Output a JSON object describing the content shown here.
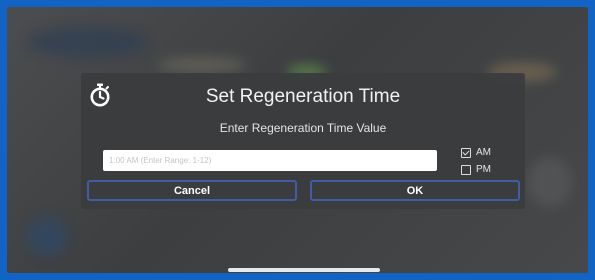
{
  "dialog": {
    "title": "Set Regeneration Time",
    "subtitle": "Enter Regeneration Time Value",
    "input_value": "",
    "input_placeholder": "1:00 AM (Enter Range: 1-12)",
    "am_label": "AM",
    "am_checked": true,
    "pm_label": "PM",
    "pm_checked": false,
    "cancel_label": "Cancel",
    "ok_label": "OK",
    "icon": "stopwatch-icon"
  },
  "colors": {
    "frame": "#1163c4",
    "button_border": "#3f5ea6",
    "dialog_bg": "#3a3c3e"
  }
}
